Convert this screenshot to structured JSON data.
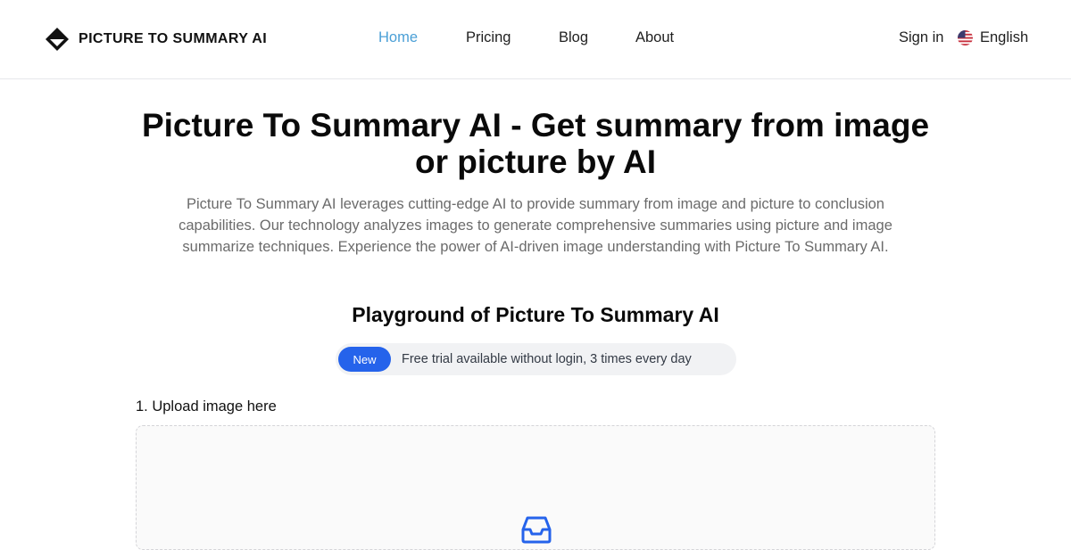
{
  "header": {
    "brand": "PICTURE TO SUMMARY AI",
    "logo_icon": "diamond-logo-icon",
    "nav": [
      {
        "label": "Home",
        "active": true
      },
      {
        "label": "Pricing",
        "active": false
      },
      {
        "label": "Blog",
        "active": false
      },
      {
        "label": "About",
        "active": false
      }
    ],
    "sign_in": "Sign in",
    "language": {
      "label": "English",
      "icon": "us-flag-icon"
    }
  },
  "hero": {
    "title": "Picture To Summary AI - Get summary from image or picture by AI",
    "description": "Picture To Summary AI leverages cutting-edge AI to provide summary from image and picture to conclusion capabilities. Our technology analyzes images to generate comprehensive summaries using picture and image summarize techniques. Experience the power of AI-driven image understanding with Picture To Summary AI."
  },
  "playground": {
    "title": "Playground of Picture To Summary AI",
    "badge": "New",
    "notice": "Free trial available without login, 3 times every day",
    "upload_label": "1. Upload image here",
    "upload_icon": "inbox-tray-icon"
  },
  "colors": {
    "accent_link": "#4a9fd6",
    "badge_bg": "#2563eb",
    "upload_icon": "#2563eb"
  }
}
